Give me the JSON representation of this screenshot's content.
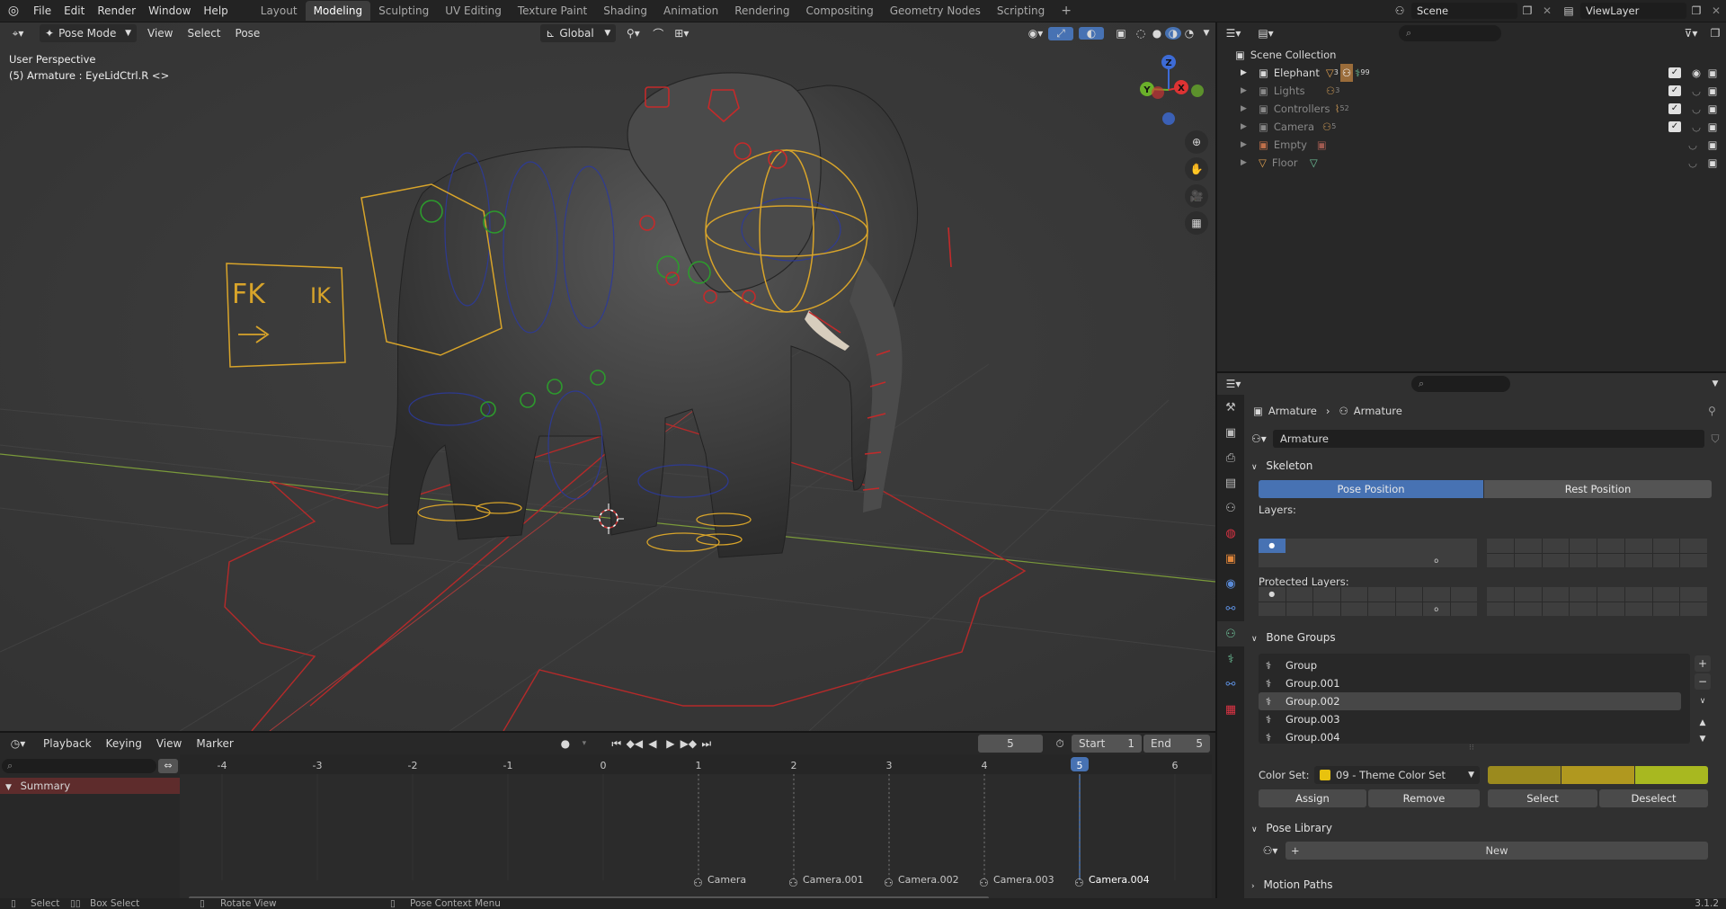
{
  "topbar": {
    "menus": [
      "File",
      "Edit",
      "Render",
      "Window",
      "Help"
    ],
    "workspaces": [
      "Layout",
      "Modeling",
      "Sculpting",
      "UV Editing",
      "Texture Paint",
      "Shading",
      "Animation",
      "Rendering",
      "Compositing",
      "Geometry Nodes",
      "Scripting"
    ],
    "active_workspace": "Modeling",
    "scene_name": "Scene",
    "view_layer": "ViewLayer"
  },
  "viewport": {
    "mode": "Pose Mode",
    "menus": [
      "View",
      "Select",
      "Pose"
    ],
    "orientation": "Global",
    "perspective_label": "User Perspective",
    "active_object_label": "(5) Armature : EyeLidCtrl.R <>",
    "fk_label": "FK",
    "ik_label": "IK",
    "gizmo_axes": [
      "Z",
      "Y",
      "X"
    ]
  },
  "outliner": {
    "root": "Scene Collection",
    "items": [
      {
        "name": "Elephant",
        "badge1": "3",
        "badge2": "99",
        "checked": true,
        "visible": true
      },
      {
        "name": "Lights",
        "badge1": "3",
        "checked": true,
        "visible": false
      },
      {
        "name": "Controllers",
        "badge1": "52",
        "checked": true,
        "visible": false
      },
      {
        "name": "Camera",
        "badge1": "5",
        "checked": true,
        "visible": false
      },
      {
        "name": "Empty",
        "checked": false,
        "visible": false
      },
      {
        "name": "Floor",
        "checked": false,
        "visible": false
      }
    ]
  },
  "properties": {
    "breadcrumb": [
      "Armature",
      "Armature"
    ],
    "data_name": "Armature",
    "skeleton": {
      "title": "Skeleton",
      "pose_position": "Pose Position",
      "rest_position": "Rest Position",
      "layers_label": "Layers:",
      "protected_layers_label": "Protected Layers:"
    },
    "bone_groups": {
      "title": "Bone Groups",
      "items": [
        "Group",
        "Group.001",
        "Group.002",
        "Group.003",
        "Group.004"
      ],
      "selected": "Group.002",
      "color_set_label": "Color Set:",
      "color_set_value": "09 - Theme Color Set",
      "colors": [
        "#9b8a1e",
        "#b0981f",
        "#a8b820"
      ],
      "assign": "Assign",
      "remove": "Remove",
      "select": "Select",
      "deselect": "Deselect"
    },
    "pose_library": {
      "title": "Pose Library",
      "new_label": "New"
    },
    "motion_paths": {
      "title": "Motion Paths"
    }
  },
  "timeline": {
    "menus": [
      "Playback",
      "Keying",
      "View",
      "Marker"
    ],
    "current_frame": "5",
    "start_label": "Start",
    "start_value": "1",
    "end_label": "End",
    "end_value": "5",
    "ruler": [
      "-4",
      "-3",
      "-2",
      "-1",
      "0",
      "1",
      "2",
      "3",
      "4",
      "5",
      "6"
    ],
    "summary_label": "Summary",
    "markers": [
      "Camera",
      "Camera.001",
      "Camera.002",
      "Camera.003",
      "Camera.004"
    ]
  },
  "statusbar": {
    "select": "Select",
    "box_select": "Box Select",
    "rotate_view": "Rotate View",
    "context_menu": "Pose Context Menu",
    "version": "3.1.2"
  }
}
